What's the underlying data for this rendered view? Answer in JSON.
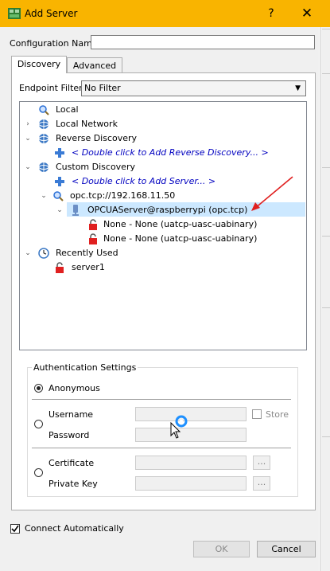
{
  "window": {
    "title": "Add Server",
    "help_label": "?",
    "close_label": "✕"
  },
  "config_name": {
    "label": "Configuration Name",
    "value": ""
  },
  "tabs": [
    {
      "label": "Discovery",
      "active": true
    },
    {
      "label": "Advanced",
      "active": false
    }
  ],
  "endpoint_filter": {
    "label": "Endpoint Filter:",
    "value": "No Filter"
  },
  "tree": {
    "local": "Local",
    "local_network": "Local Network",
    "reverse_discovery": "Reverse Discovery",
    "reverse_add": "< Double click to Add Reverse Discovery... >",
    "custom_discovery": "Custom Discovery",
    "custom_add": "< Double click to Add Server... >",
    "server_url": "opc.tcp://192.168.11.50",
    "server_node": "OPCUAServer@raspberrypi (opc.tcp)",
    "endpoint_1": "None - None (uatcp-uasc-uabinary)",
    "endpoint_2": "None - None (uatcp-uasc-uabinary)",
    "recently_used": "Recently Used",
    "recent_server": "server1"
  },
  "auth": {
    "title": "Authentication Settings",
    "anonymous": "Anonymous",
    "username": "Username",
    "password": "Password",
    "store": "Store",
    "certificate": "Certificate",
    "private_key": "Private Key",
    "browse": "...",
    "selected": "Anonymous"
  },
  "connect_automatically": {
    "label": "Connect Automatically",
    "checked": true
  },
  "buttons": {
    "ok": "OK",
    "cancel": "Cancel"
  },
  "colors": {
    "title_bar": "#f9b400",
    "selection": "#cce8ff",
    "link": "#0000c0",
    "annotation_arrow": "#e02020"
  }
}
